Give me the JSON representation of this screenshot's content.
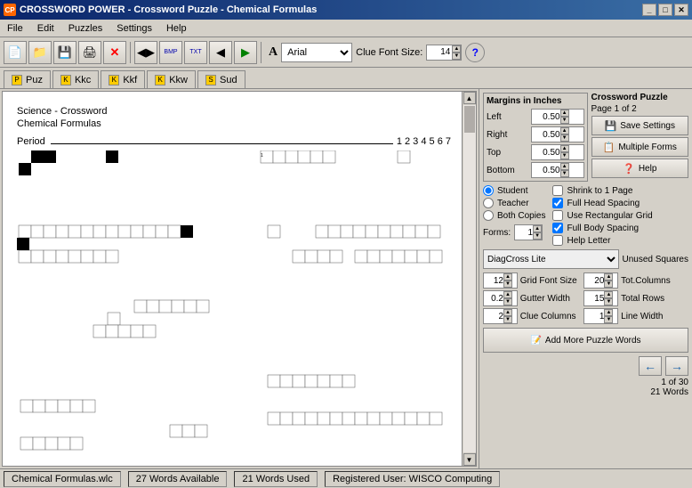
{
  "titleBar": {
    "icon": "CP",
    "title": "CROSSWORD POWER - Crossword Puzzle - Chemical Formulas",
    "minLabel": "_",
    "maxLabel": "□",
    "closeLabel": "✕"
  },
  "menuBar": {
    "items": [
      "File",
      "Edit",
      "Puzzles",
      "Settings",
      "Help"
    ]
  },
  "toolbar": {
    "fontLabel": "A",
    "fontValue": "Arial",
    "clueFontLabel": "Clue Font Size:",
    "clueFontValue": "14",
    "helpLabel": "?"
  },
  "fileTabs": {
    "tabs": [
      "Puz",
      "Kkc",
      "Kkf",
      "Kkw",
      "Sud"
    ]
  },
  "puzzle": {
    "title": "Science - Crossword",
    "subtitle": "Chemical Formulas",
    "periodLabel": "Period",
    "periodNums": "1  2  3  4  5  6  7"
  },
  "margins": {
    "title": "Margins in Inches",
    "labels": [
      "Left",
      "Right",
      "Top",
      "Bottom"
    ],
    "values": [
      "0.50",
      "0.50",
      "0.50",
      "0.50"
    ]
  },
  "puzzleSection": {
    "title": "Crossword Puzzle",
    "subtitle": "Page 1 of 2",
    "saveLabel": "Save Settings",
    "multipleLabel": "Multiple Forms",
    "helpLabel": "Help"
  },
  "options": {
    "radioItems": [
      "Student",
      "Teacher",
      "Both Copies"
    ],
    "formsLabel": "Forms:",
    "formsValue": "1",
    "checkboxItems": [
      {
        "label": "Shrink to 1 Page",
        "checked": false
      },
      {
        "label": "Full Head Spacing",
        "checked": true
      },
      {
        "label": "Use Rectangular Grid",
        "checked": false
      },
      {
        "label": "Full Body Spacing",
        "checked": true
      }
    ],
    "helpLetterLabel": "Help Letter"
  },
  "fontRow": {
    "fontValue": "DiagCross Lite",
    "unusedLabel": "Unused Squares"
  },
  "gridSettings": {
    "gridFontSizeLabel": "Grid Font Size",
    "gridFontSizeValue": "12",
    "totColumnsLabel": "Tot.Columns",
    "totColumnsValue": "20",
    "gutterWidthLabel": "Gutter Width",
    "gutterWidthValue": "0.2",
    "totalRowsLabel": "Total Rows",
    "totalRowsValue": "15",
    "clueColumnsLabel": "Clue Columns",
    "clueColumnsValue": "2",
    "lineWidthLabel": "Line Width",
    "lineWidthValue": "1"
  },
  "addPuzzleBtn": {
    "label": "Add More Puzzle Words"
  },
  "navSection": {
    "leftArrow": "←",
    "rightArrow": "→",
    "pageInfo1": "1 of 30",
    "pageInfo2": "21 Words"
  },
  "statusBar": {
    "file": "Chemical Formulas.wlc",
    "wordsAvail": "27 Words Available",
    "wordsUsed": "21 Words Used",
    "user": "Registered User: WISCO Computing"
  }
}
